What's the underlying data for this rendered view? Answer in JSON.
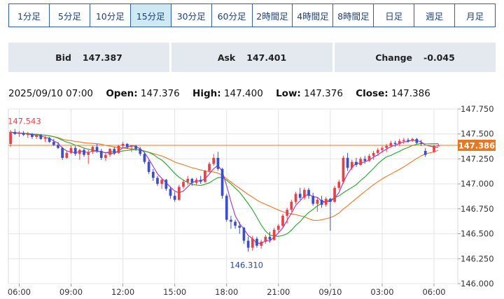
{
  "tabs": [
    {
      "label": "1分足",
      "active": false
    },
    {
      "label": "5分足",
      "active": false
    },
    {
      "label": "10分足",
      "active": false
    },
    {
      "label": "15分足",
      "active": true
    },
    {
      "label": "30分足",
      "active": false
    },
    {
      "label": "60分足",
      "active": false
    },
    {
      "label": "2時間足",
      "active": false
    },
    {
      "label": "4時間足",
      "active": false
    },
    {
      "label": "8時間足",
      "active": false
    },
    {
      "label": "日足",
      "active": false
    },
    {
      "label": "週足",
      "active": false
    },
    {
      "label": "月足",
      "active": false
    }
  ],
  "quotes": {
    "bid_label": "Bid",
    "bid_value": "147.387",
    "ask_label": "Ask",
    "ask_value": "147.401",
    "change_label": "Change",
    "change_value": "-0.045"
  },
  "ohlc": {
    "datetime": "2025/09/10 07:00",
    "open_label": "Open:",
    "open": "147.376",
    "high_label": "High:",
    "high": "147.400",
    "low_label": "Low:",
    "low": "147.376",
    "close_label": "Close:",
    "close": "147.386"
  },
  "chart_data": {
    "type": "candlestick",
    "interval": "15分足",
    "y_ticks": [
      "147.750",
      "147.500",
      "147.250",
      "147.000",
      "146.750",
      "146.500",
      "146.250",
      "146.000"
    ],
    "ylim": [
      146.0,
      147.75
    ],
    "x_ticks": [
      {
        "label": "06:00",
        "i": 2
      },
      {
        "label": "09:00",
        "i": 14
      },
      {
        "label": "12:00",
        "i": 26
      },
      {
        "label": "15:00",
        "i": 38
      },
      {
        "label": "18:00",
        "i": 50
      },
      {
        "label": "21:00",
        "i": 62
      },
      {
        "label": "09/10",
        "i": 74
      },
      {
        "label": "03:00",
        "i": 86
      },
      {
        "label": "06:00",
        "i": 98
      }
    ],
    "n_slots": 104,
    "max_label": {
      "text": "147.543",
      "value": 147.543,
      "i": 0
    },
    "min_label": {
      "text": "146.310",
      "value": 146.31,
      "i": 54
    },
    "last_price": {
      "text": "147.386",
      "value": 147.386
    },
    "colors": {
      "up": "#e8404a",
      "down": "#3b4fc8",
      "ma_fast": "#9b2fc9",
      "ma_mid": "#1fa626",
      "ma_slow": "#e8781f",
      "price_line": "#e8781f"
    },
    "candles": [
      [
        147.4,
        147.54,
        147.37,
        147.52
      ],
      [
        147.52,
        147.55,
        147.49,
        147.5
      ],
      [
        147.5,
        147.53,
        147.47,
        147.51
      ],
      [
        147.51,
        147.53,
        147.48,
        147.49
      ],
      [
        147.49,
        147.52,
        147.46,
        147.5
      ],
      [
        147.5,
        147.51,
        147.45,
        147.47
      ],
      [
        147.47,
        147.5,
        147.45,
        147.49
      ],
      [
        147.49,
        147.5,
        147.44,
        147.45
      ],
      [
        147.45,
        147.48,
        147.42,
        147.46
      ],
      [
        147.46,
        147.47,
        147.41,
        147.42
      ],
      [
        147.42,
        147.45,
        147.38,
        147.39
      ],
      [
        147.39,
        147.42,
        147.35,
        147.36
      ],
      [
        147.36,
        147.37,
        147.24,
        147.26
      ],
      [
        147.26,
        147.33,
        147.25,
        147.31
      ],
      [
        147.31,
        147.38,
        147.3,
        147.36
      ],
      [
        147.36,
        147.38,
        147.28,
        147.3
      ],
      [
        147.3,
        147.35,
        147.24,
        147.34
      ],
      [
        147.34,
        147.36,
        147.27,
        147.29
      ],
      [
        147.29,
        147.34,
        147.2,
        147.32
      ],
      [
        147.32,
        147.38,
        147.3,
        147.37
      ],
      [
        147.37,
        147.4,
        147.31,
        147.33
      ],
      [
        147.33,
        147.35,
        147.24,
        147.26
      ],
      [
        147.26,
        147.31,
        147.23,
        147.29
      ],
      [
        147.29,
        147.36,
        147.27,
        147.35
      ],
      [
        147.35,
        147.37,
        147.29,
        147.31
      ],
      [
        147.31,
        147.39,
        147.3,
        147.38
      ],
      [
        147.38,
        147.42,
        147.36,
        147.4
      ],
      [
        147.4,
        147.41,
        147.35,
        147.37
      ],
      [
        147.37,
        147.39,
        147.32,
        147.38
      ],
      [
        147.38,
        147.39,
        147.33,
        147.35
      ],
      [
        147.35,
        147.37,
        147.28,
        147.3
      ],
      [
        147.3,
        147.32,
        147.2,
        147.22
      ],
      [
        147.22,
        147.24,
        147.1,
        147.12
      ],
      [
        147.12,
        147.15,
        147.03,
        147.06
      ],
      [
        147.06,
        147.08,
        146.98,
        147.0
      ],
      [
        147.0,
        147.06,
        146.95,
        147.04
      ],
      [
        147.04,
        147.05,
        146.93,
        146.95
      ],
      [
        146.95,
        146.97,
        146.85,
        146.88
      ],
      [
        146.88,
        146.92,
        146.82,
        146.84
      ],
      [
        146.84,
        146.99,
        146.83,
        146.97
      ],
      [
        146.97,
        147.04,
        146.95,
        147.02
      ],
      [
        147.02,
        147.08,
        146.99,
        147.05
      ],
      [
        147.05,
        147.06,
        146.98,
        147.01
      ],
      [
        147.01,
        147.06,
        146.99,
        147.04
      ],
      [
        147.04,
        147.08,
        147.0,
        147.02
      ],
      [
        147.02,
        147.14,
        147.01,
        147.13
      ],
      [
        147.13,
        147.22,
        147.11,
        147.2
      ],
      [
        147.2,
        147.3,
        147.18,
        147.26
      ],
      [
        147.26,
        147.32,
        147.13,
        147.15
      ],
      [
        147.15,
        147.16,
        146.85,
        146.88
      ],
      [
        146.88,
        146.9,
        146.62,
        146.64
      ],
      [
        146.64,
        146.68,
        146.55,
        146.62
      ],
      [
        146.62,
        146.64,
        146.55,
        146.58
      ],
      [
        146.58,
        146.62,
        146.5,
        146.56
      ],
      [
        146.56,
        146.57,
        146.4,
        146.43
      ],
      [
        146.43,
        146.47,
        146.32,
        146.36
      ],
      [
        146.36,
        146.48,
        146.33,
        146.45
      ],
      [
        146.45,
        146.47,
        146.36,
        146.38
      ],
      [
        146.38,
        146.44,
        146.35,
        146.42
      ],
      [
        146.42,
        146.49,
        146.4,
        146.47
      ],
      [
        146.47,
        146.52,
        146.41,
        146.44
      ],
      [
        146.44,
        146.56,
        146.43,
        146.54
      ],
      [
        146.54,
        146.6,
        146.51,
        146.58
      ],
      [
        146.58,
        146.7,
        146.56,
        146.68
      ],
      [
        146.68,
        146.76,
        146.6,
        146.74
      ],
      [
        146.74,
        146.84,
        146.72,
        146.82
      ],
      [
        146.82,
        146.92,
        146.8,
        146.9
      ],
      [
        146.9,
        146.96,
        146.84,
        146.86
      ],
      [
        146.86,
        146.96,
        146.84,
        146.94
      ],
      [
        146.94,
        146.96,
        146.85,
        146.88
      ],
      [
        146.88,
        146.91,
        146.78,
        146.8
      ],
      [
        146.8,
        146.86,
        146.72,
        146.84
      ],
      [
        146.84,
        146.88,
        146.76,
        146.79
      ],
      [
        146.79,
        146.87,
        146.77,
        146.85
      ],
      [
        146.85,
        146.86,
        146.53,
        146.82
      ],
      [
        146.82,
        146.98,
        146.81,
        146.96
      ],
      [
        146.96,
        147.04,
        146.94,
        147.02
      ],
      [
        147.02,
        147.28,
        147.0,
        147.26
      ],
      [
        147.26,
        147.31,
        147.13,
        147.16
      ],
      [
        147.16,
        147.24,
        147.14,
        147.22
      ],
      [
        147.22,
        147.26,
        147.17,
        147.19
      ],
      [
        147.19,
        147.27,
        147.18,
        147.25
      ],
      [
        147.25,
        147.28,
        147.2,
        147.23
      ],
      [
        147.23,
        147.3,
        147.22,
        147.28
      ],
      [
        147.28,
        147.33,
        147.24,
        147.31
      ],
      [
        147.31,
        147.36,
        147.28,
        147.34
      ],
      [
        147.34,
        147.38,
        147.31,
        147.36
      ],
      [
        147.36,
        147.4,
        147.32,
        147.38
      ],
      [
        147.38,
        147.43,
        147.36,
        147.41
      ],
      [
        147.41,
        147.43,
        147.37,
        147.4
      ],
      [
        147.4,
        147.45,
        147.38,
        147.43
      ],
      [
        147.43,
        147.46,
        147.4,
        147.44
      ],
      [
        147.44,
        147.46,
        147.41,
        147.43
      ],
      [
        147.43,
        147.46,
        147.42,
        147.45
      ],
      [
        147.45,
        147.46,
        147.4,
        147.41
      ],
      [
        147.41,
        147.44,
        147.38,
        147.4
      ],
      [
        147.33,
        147.36,
        147.27,
        147.29
      ],
      [
        147.32,
        147.39,
        147.31,
        147.38
      ],
      [
        147.376,
        147.4,
        147.376,
        147.386
      ]
    ],
    "candle_slots": [
      0,
      1,
      2,
      3,
      4,
      5,
      6,
      7,
      8,
      9,
      10,
      11,
      12,
      13,
      14,
      15,
      16,
      17,
      18,
      19,
      20,
      21,
      22,
      23,
      24,
      25,
      26,
      27,
      28,
      29,
      30,
      31,
      32,
      33,
      34,
      35,
      36,
      37,
      38,
      39,
      40,
      41,
      42,
      43,
      44,
      45,
      46,
      47,
      48,
      49,
      50,
      51,
      52,
      53,
      54,
      55,
      56,
      57,
      58,
      59,
      60,
      61,
      62,
      63,
      64,
      65,
      66,
      67,
      68,
      69,
      70,
      71,
      72,
      73,
      74,
      75,
      76,
      77,
      78,
      79,
      80,
      81,
      82,
      83,
      84,
      85,
      86,
      87,
      88,
      89,
      90,
      91,
      92,
      93,
      94,
      95,
      96,
      98,
      99,
      101
    ]
  }
}
